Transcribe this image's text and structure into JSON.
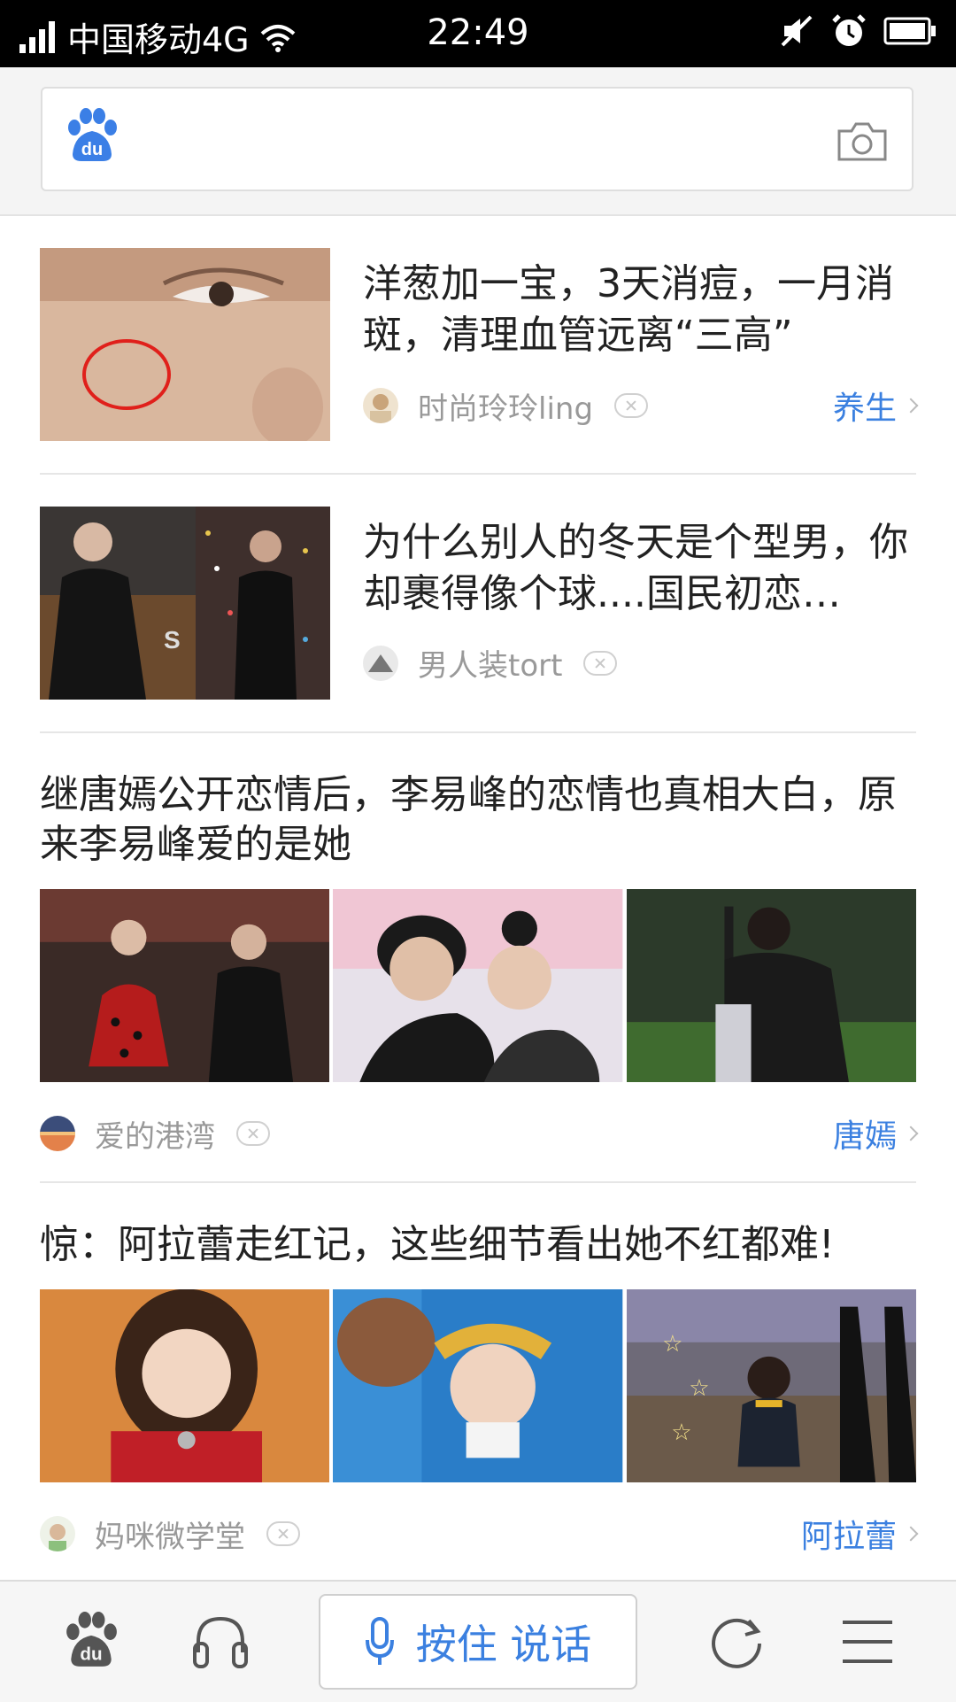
{
  "status_bar": {
    "carrier": "中国移动4G",
    "time": "22:49",
    "icons": [
      "signal-icon",
      "wifi-icon",
      "mute-icon",
      "alarm-icon",
      "battery-icon"
    ]
  },
  "search": {
    "logo": "du",
    "camera_icon": "camera-icon"
  },
  "feed": [
    {
      "layout": "small",
      "title": "洋葱加一宝，3天消痘，一月消斑，清理血管远离“三高”",
      "source": "时尚玲玲ling",
      "tag": "养生"
    },
    {
      "layout": "small",
      "title": "为什么别人的冬天是个型男，你却裹得像个球....国民初恋…",
      "source": "男人装tort",
      "tag": ""
    },
    {
      "layout": "three",
      "title": "继唐嫣公开恋情后，李易峰的恋情也真相大白，原来李易峰爱的是她",
      "source": "爱的港湾",
      "tag": "唐嫣"
    },
    {
      "layout": "three",
      "title": "惊：阿拉蕾走红记，这些细节看出她不红都难!",
      "source": "妈咪微学堂",
      "tag": "阿拉蕾"
    }
  ],
  "bottom_bar": {
    "voice_label": "按住 说话",
    "icons": [
      "baidu-paw-icon",
      "headphones-icon",
      "microphone-icon",
      "refresh-icon",
      "menu-icon"
    ]
  },
  "colors": {
    "accent": "#3b80e0",
    "status_bar": "#000000",
    "text": "#222222",
    "meta": "#999999"
  }
}
